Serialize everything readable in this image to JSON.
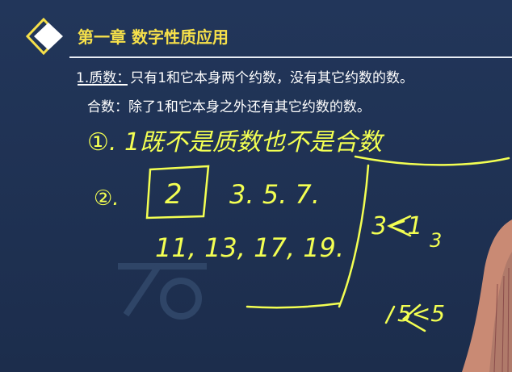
{
  "slide": {
    "chapter_title": "第一章 数字性质应用",
    "definition_prime": "1.质数：只有1和它本身两个约数，没有其它约数的数。",
    "definition_composite": "合数：除了1和它本身之外还有其它约数的数。"
  },
  "handwriting": {
    "line1": "①. 1既不是质数也不是合数",
    "line2_label": "②.",
    "boxed_number": "2",
    "primes_row1": "3. 5. 7.",
    "primes_row2": "11, 13, 17, 19.",
    "factor_1": "3<1",
    "factor_1b": "3",
    "factor_2": "5<5"
  },
  "colors": {
    "background": "#1d2f4f",
    "title": "#f6e04a",
    "text": "#ffffff",
    "ink": "#f3ff52"
  }
}
